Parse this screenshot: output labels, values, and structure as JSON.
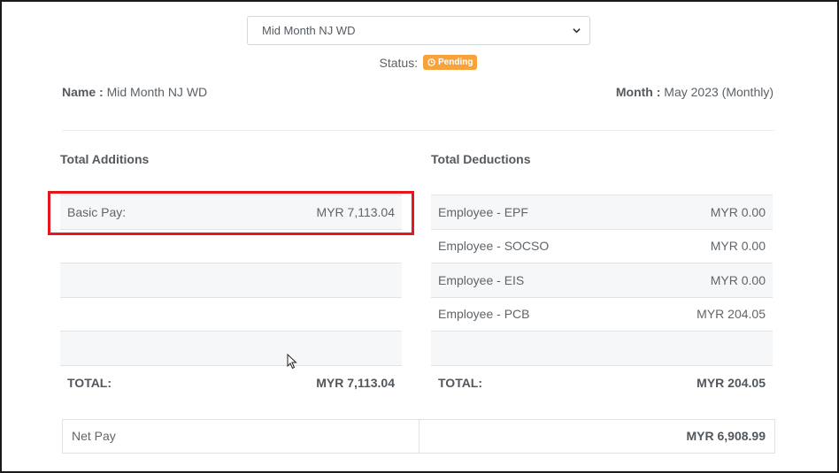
{
  "select": {
    "value": "Mid Month NJ WD"
  },
  "status": {
    "label": "Status:",
    "badge": "Pending",
    "badge_color": "#f7a23b"
  },
  "header": {
    "name_key": "Name :",
    "name_value": "Mid Month NJ WD",
    "month_key": "Month :",
    "month_value": "May 2023 (Monthly)"
  },
  "additions": {
    "title": "Total Additions",
    "rows": [
      {
        "label": "Basic Pay:",
        "value": "MYR 7,113.04"
      },
      {
        "label": "",
        "value": ""
      },
      {
        "label": "",
        "value": ""
      },
      {
        "label": "",
        "value": ""
      },
      {
        "label": "",
        "value": ""
      }
    ],
    "total_label": "TOTAL:",
    "total_value": "MYR 7,113.04"
  },
  "deductions": {
    "title": "Total Deductions",
    "rows": [
      {
        "label": "Employee - EPF",
        "value": "MYR 0.00"
      },
      {
        "label": "Employee - SOCSO",
        "value": "MYR 0.00"
      },
      {
        "label": "Employee - EIS",
        "value": "MYR 0.00"
      },
      {
        "label": "Employee - PCB",
        "value": "MYR 204.05"
      },
      {
        "label": "",
        "value": ""
      }
    ],
    "total_label": "TOTAL:",
    "total_value": "MYR 204.05"
  },
  "net_pay": {
    "label": "Net Pay",
    "value": "MYR 6,908.99"
  },
  "colors": {
    "highlight": "#e3171c"
  }
}
